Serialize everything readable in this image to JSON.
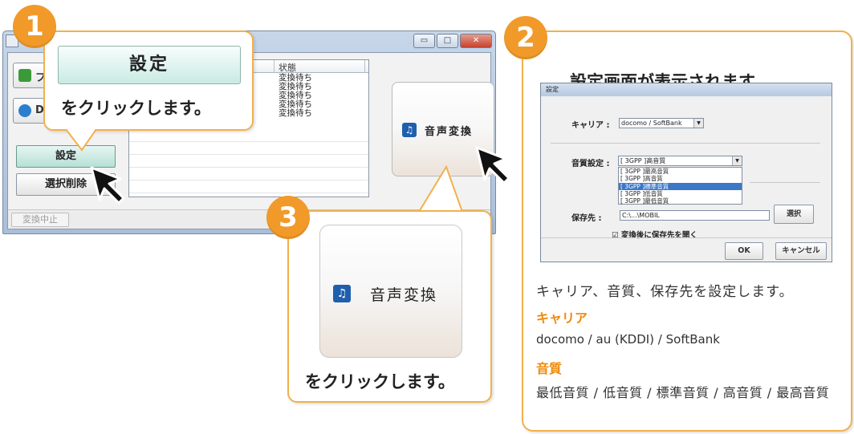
{
  "app_window": {
    "file_button_label": "フ",
    "dvd_button_label": "D",
    "settings_button_label": "設定",
    "delete_button_label": "選択削除",
    "list": {
      "status_header": "状態",
      "statuses": [
        "変換待ち",
        "変換待ち",
        "変換待ち",
        "変換待ち",
        "変換待ち"
      ]
    },
    "convert_button_label": "音声変換",
    "stop_button_label": "変換中止",
    "window_buttons": {
      "minimize": "▭",
      "maximize": "□",
      "close": "✕"
    }
  },
  "callout1": {
    "number": "1",
    "button_label": "設定",
    "text": "をクリックします。"
  },
  "callout3": {
    "number": "3",
    "button_label": "音声変換",
    "text": "をクリックします。"
  },
  "panel2": {
    "number": "2",
    "title": "設定画面が表示されます。",
    "dialog": {
      "title": "設定",
      "carrier_label": "キャリア :",
      "carrier_value": "docomo / SoftBank",
      "quality_label": "音質設定 :",
      "quality_value": "[ 3GPP ]高音質",
      "quality_options": [
        "[ 3GPP ]最高音質",
        "[ 3GPP ]高音質",
        "[ 3GPP ]標準音質",
        "[ 3GPP ]低音質",
        "[ 3GPP ]最低音質"
      ],
      "save_label": "保存先 :",
      "save_path": "C:\\...\\MOBIL",
      "choose_button": "選択",
      "open_after_checkbox": "☑ 変換後に保存先を開く",
      "ok_button": "OK",
      "cancel_button": "キャンセル"
    },
    "description": "キャリア、音質、保存先を設定します。",
    "carrier_heading": "キャリア",
    "carrier_list": "docomo / au (KDDI) / SoftBank",
    "quality_heading": "音質",
    "quality_list": "最低音質 / 低音質 / 標準音質 / 高音質 / 最高音質"
  },
  "colors": {
    "accent_orange": "#f19a2a",
    "heading_orange": "#f08a0c",
    "callout_border": "#f2b04c",
    "window_frame": "#a9bfd9"
  }
}
